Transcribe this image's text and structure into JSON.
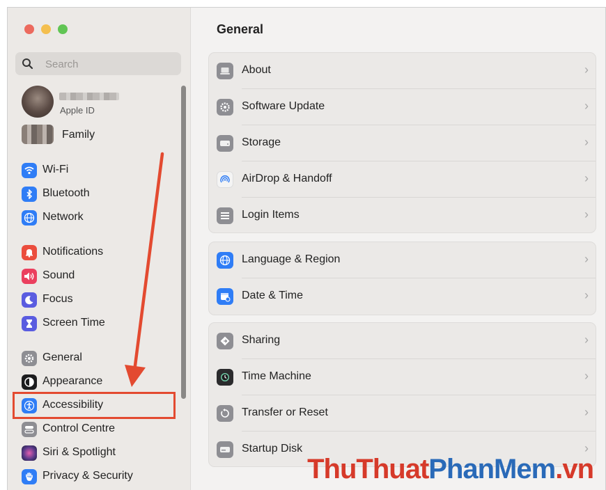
{
  "sidebar": {
    "search_placeholder": "Search",
    "profile": {
      "sub": "Apple ID"
    },
    "family": "Family",
    "items": [
      {
        "label": "Wi-Fi",
        "icon": "wifi-icon",
        "color": "#2f7df6"
      },
      {
        "label": "Bluetooth",
        "icon": "bluetooth-icon",
        "color": "#2f7df6"
      },
      {
        "label": "Network",
        "icon": "globe-icon",
        "color": "#2f7df6"
      },
      {
        "label": "Notifications",
        "icon": "bell-icon",
        "color": "#eb4d3d"
      },
      {
        "label": "Sound",
        "icon": "speaker-icon",
        "color": "#eb3f5e"
      },
      {
        "label": "Focus",
        "icon": "moon-icon",
        "color": "#5a5ce0"
      },
      {
        "label": "Screen Time",
        "icon": "hourglass-icon",
        "color": "#5a5ce0"
      },
      {
        "label": "General",
        "icon": "gear-icon",
        "color": "#8e8e93"
      },
      {
        "label": "Appearance",
        "icon": "appearance-icon",
        "color": "#1c1c1e"
      },
      {
        "label": "Accessibility",
        "icon": "accessibility-icon",
        "color": "#2f7df6"
      },
      {
        "label": "Control Centre",
        "icon": "control-centre-icon",
        "color": "#8e8e93"
      },
      {
        "label": "Siri & Spotlight",
        "icon": "siri-icon",
        "color": "#5a3a8a"
      },
      {
        "label": "Privacy & Security",
        "icon": "hand-icon",
        "color": "#2f7df6"
      }
    ]
  },
  "main": {
    "title": "General",
    "groups": [
      [
        {
          "label": "About",
          "icon": "laptop-icon"
        },
        {
          "label": "Software Update",
          "icon": "gear-update-icon"
        },
        {
          "label": "Storage",
          "icon": "drive-icon"
        },
        {
          "label": "AirDrop & Handoff",
          "icon": "airdrop-icon"
        },
        {
          "label": "Login Items",
          "icon": "list-icon"
        }
      ],
      [
        {
          "label": "Language & Region",
          "icon": "globe-icon"
        },
        {
          "label": "Date & Time",
          "icon": "calendar-clock-icon"
        }
      ],
      [
        {
          "label": "Sharing",
          "icon": "sharing-icon"
        },
        {
          "label": "Time Machine",
          "icon": "time-machine-icon"
        },
        {
          "label": "Transfer or Reset",
          "icon": "reset-icon"
        },
        {
          "label": "Startup Disk",
          "icon": "disk-icon"
        }
      ]
    ]
  },
  "watermark": {
    "part1": "ThuThuat",
    "part2": "PhanMem",
    "part3": ".vn"
  }
}
